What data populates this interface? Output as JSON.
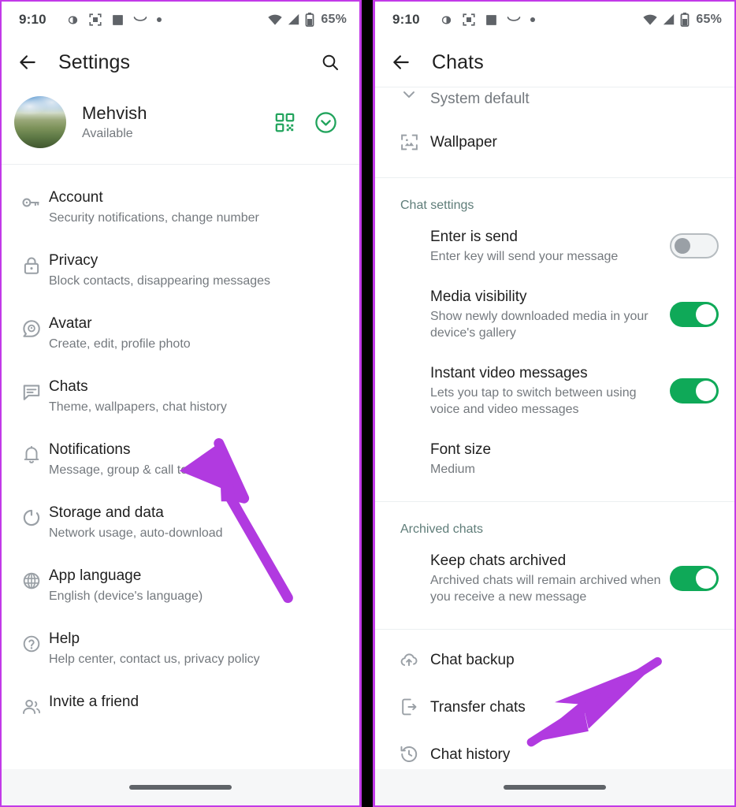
{
  "status_bar": {
    "time": "9:10",
    "battery_percent": "65%",
    "icons": [
      "contrast-pill-icon",
      "focus-frame-icon",
      "filled-square-icon",
      "arc-icon",
      "dot-icon",
      "wifi-icon",
      "cellular-signal-icon",
      "battery-icon"
    ]
  },
  "colors": {
    "accent_green": "#0fa958",
    "brand_green": "#22a45d",
    "annotation_purple": "#b13ae0",
    "frame_purple": "#c23ae8",
    "primary_text": "#1f1f1f",
    "secondary_text": "#74797e",
    "section_header": "#5f7d79"
  },
  "left_panel": {
    "app_bar": {
      "title": "Settings",
      "back_icon": "arrow-left-icon",
      "search_icon": "search-icon"
    },
    "profile": {
      "name": "Mehvish",
      "status": "Available",
      "qr_icon": "qr-code-icon",
      "expand_icon": "chevron-down-circle-icon"
    },
    "items": [
      {
        "icon": "key-icon",
        "title": "Account",
        "subtitle": "Security notifications, change number"
      },
      {
        "icon": "lock-icon",
        "title": "Privacy",
        "subtitle": "Block contacts, disappearing messages"
      },
      {
        "icon": "avatar-icon",
        "title": "Avatar",
        "subtitle": "Create, edit, profile photo"
      },
      {
        "icon": "chat-icon",
        "title": "Chats",
        "subtitle": "Theme, wallpapers, chat history"
      },
      {
        "icon": "bell-icon",
        "title": "Notifications",
        "subtitle": "Message, group & call tones"
      },
      {
        "icon": "storage-icon",
        "title": "Storage and data",
        "subtitle": "Network usage, auto-download"
      },
      {
        "icon": "globe-icon",
        "title": "App language",
        "subtitle": "English (device's language)"
      },
      {
        "icon": "help-icon",
        "title": "Help",
        "subtitle": "Help center, contact us, privacy policy"
      },
      {
        "icon": "people-icon",
        "title": "Invite a friend",
        "subtitle": ""
      }
    ]
  },
  "right_panel": {
    "app_bar": {
      "title": "Chats",
      "back_icon": "arrow-left-icon"
    },
    "top_items": [
      {
        "icon": "chevron-down-icon",
        "title": "System default",
        "subtitle": "",
        "muted": true
      },
      {
        "icon": "wallpaper-icon",
        "title": "Wallpaper",
        "subtitle": ""
      }
    ],
    "chat_settings": {
      "header": "Chat settings",
      "items": [
        {
          "title": "Enter is send",
          "subtitle": "Enter key will send your message",
          "toggle": "off"
        },
        {
          "title": "Media visibility",
          "subtitle": "Show newly downloaded media in your device's gallery",
          "toggle": "on"
        },
        {
          "title": "Instant video messages",
          "subtitle": "Lets you tap to switch between using voice and video messages",
          "toggle": "on"
        },
        {
          "title": "Font size",
          "subtitle": "Medium",
          "toggle": "none"
        }
      ]
    },
    "archived_chats": {
      "header": "Archived chats",
      "items": [
        {
          "title": "Keep chats archived",
          "subtitle": "Archived chats will remain archived when you receive a new message",
          "toggle": "on"
        }
      ]
    },
    "bottom_items": [
      {
        "icon": "cloud-upload-icon",
        "title": "Chat backup"
      },
      {
        "icon": "phone-export-icon",
        "title": "Transfer chats"
      },
      {
        "icon": "history-clock-icon",
        "title": "Chat history"
      }
    ]
  },
  "annotations": [
    {
      "name": "arrow-to-chats",
      "points_at": "Chats"
    },
    {
      "name": "arrow-to-chat-history",
      "points_at": "Chat history"
    }
  ]
}
